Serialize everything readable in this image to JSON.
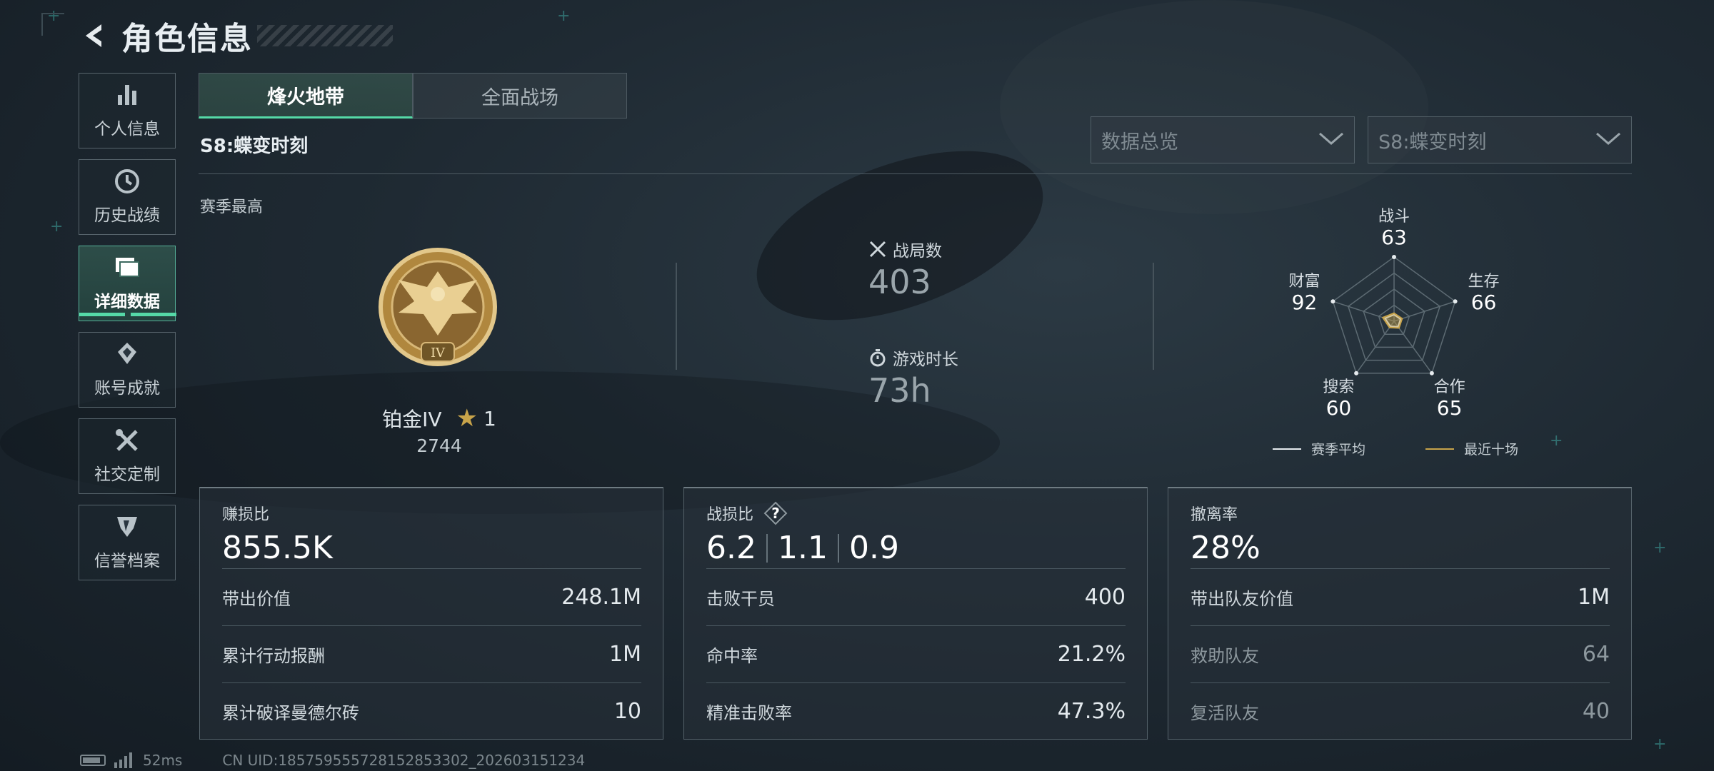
{
  "header": {
    "title": "角色信息",
    "back_icon": "back-arrow-icon"
  },
  "sidebar": {
    "items": [
      {
        "label": "个人信息",
        "icon": "bar-chart-icon",
        "active": false
      },
      {
        "label": "历史战绩",
        "icon": "history-clock-icon",
        "active": false
      },
      {
        "label": "详细数据",
        "icon": "folder-icon",
        "active": true
      },
      {
        "label": "账号成就",
        "icon": "achievement-icon",
        "active": false
      },
      {
        "label": "社交定制",
        "icon": "tools-icon",
        "active": false
      },
      {
        "label": "信誉档案",
        "icon": "shield-icon",
        "active": false
      }
    ]
  },
  "tabs": [
    {
      "label": "烽火地带",
      "active": true
    },
    {
      "label": "全面战场",
      "active": false
    }
  ],
  "season_label": "S8:蝶变时刻",
  "filters": {
    "data_type": {
      "value": "数据总览"
    },
    "season": {
      "value": "S8:蝶变时刻"
    }
  },
  "season_best": {
    "label": "赛季最高",
    "rank_name": "铂金IV",
    "stars": "1",
    "score": "2744"
  },
  "stats": {
    "matches": {
      "label": "战局数",
      "value": "403"
    },
    "playtime": {
      "label": "游戏时长",
      "value": "73h"
    }
  },
  "radar": {
    "axes": [
      {
        "label": "战斗",
        "value": "63"
      },
      {
        "label": "生存",
        "value": "66"
      },
      {
        "label": "合作",
        "value": "65"
      },
      {
        "label": "搜索",
        "value": "60"
      },
      {
        "label": "财富",
        "value": "92"
      }
    ],
    "legend": {
      "season_avg": "赛季平均",
      "recent_ten": "最近十场"
    },
    "colors": {
      "season_avg": "#e6ebee",
      "recent_ten": "#c8a44a"
    }
  },
  "cards": {
    "profit": {
      "title": "赚损比",
      "value": "855.5K",
      "rows": [
        {
          "label": "带出价值",
          "value": "248.1M"
        },
        {
          "label": "累计行动报酬",
          "value": "1M"
        },
        {
          "label": "累计破译曼德尔砖",
          "value": "10"
        }
      ]
    },
    "kd": {
      "title": "战损比",
      "values": [
        "6.2",
        "1.1",
        "0.9"
      ],
      "rows": [
        {
          "label": "击败干员",
          "value": "400"
        },
        {
          "label": "命中率",
          "value": "21.2%"
        },
        {
          "label": "精准击败率",
          "value": "47.3%"
        }
      ]
    },
    "extract": {
      "title": "撤离率",
      "value": "28%",
      "rows": [
        {
          "label": "带出队友价值",
          "value": "1M"
        },
        {
          "label": "救助队友",
          "value": "64"
        },
        {
          "label": "复活队友",
          "value": "40"
        }
      ]
    }
  },
  "footer": {
    "ping": "52ms",
    "uid": "CN UID:18575955572815285330­2_202603151234"
  },
  "colors": {
    "accent": "#55d9a7",
    "gold": "#c8a44a"
  }
}
